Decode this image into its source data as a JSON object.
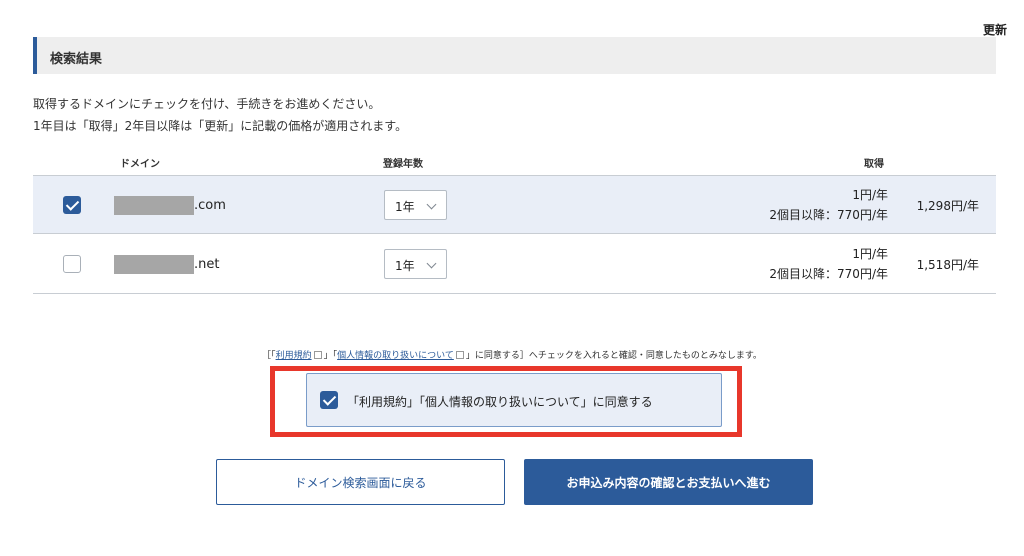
{
  "section": {
    "title": "検索結果"
  },
  "description": {
    "line1": "取得するドメインにチェックを付け、手続きをお進めください。",
    "line2": "1年目は「取得」2年目以降は「更新」に記載の価格が適用されます。"
  },
  "table": {
    "headers": {
      "domain": "ドメイン",
      "years": "登録年数",
      "acquire": "取得",
      "renew": "更新"
    },
    "rows": [
      {
        "checked": true,
        "tld": ".com",
        "years": "1年",
        "acquire_price": "1円/年",
        "acquire_note": "2個目以降：770円/年",
        "renew_price": "1,298円/年"
      },
      {
        "checked": false,
        "tld": ".net",
        "years": "1年",
        "acquire_price": "1円/年",
        "acquire_note": "2個目以降：770円/年",
        "renew_price": "1,518円/年"
      }
    ]
  },
  "agreement": {
    "note_open": "［「",
    "terms_link": "利用規約",
    "note_mid": "」「",
    "privacy_link": "個人情報の取り扱いについて",
    "note_end": "」に同意する］へチェックを入れると確認・同意したものとみなします。",
    "checkbox_label": "「利用規約」「個人情報の取り扱いについて」に同意する",
    "checked": true
  },
  "buttons": {
    "back": "ドメイン検索画面に戻る",
    "next": "お申込み内容の確認とお支払いへ進む"
  },
  "colors": {
    "primary": "#2c5b9a",
    "highlight": "#e8372b",
    "row_selected": "#e9eef7"
  }
}
